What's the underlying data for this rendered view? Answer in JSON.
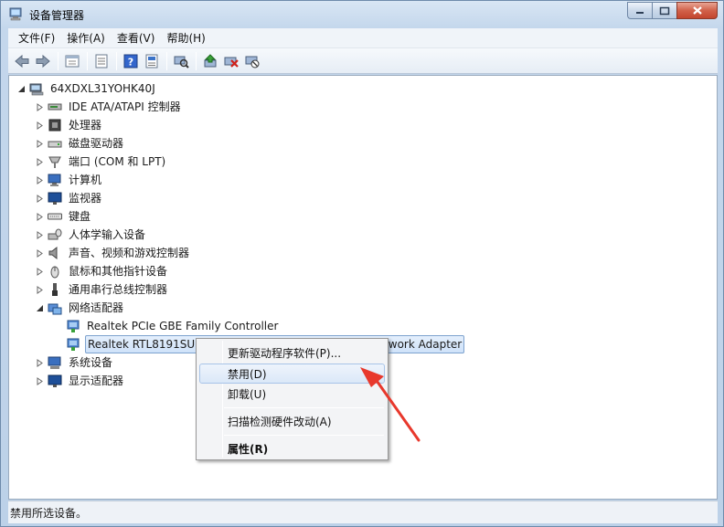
{
  "window": {
    "title": "设备管理器",
    "icons": {
      "app": "device-manager-icon",
      "minimize": "minimize-icon",
      "maximize": "maximize-icon",
      "close": "close-icon"
    }
  },
  "menu": [
    "文件(F)",
    "操作(A)",
    "查看(V)",
    "帮助(H)"
  ],
  "toolbar": {
    "buttons": [
      "back-icon",
      "forward-icon",
      "properties-view-icon",
      "list-view-icon",
      "help-icon",
      "resources-icon",
      "scan-hardware-icon",
      "update-driver-icon",
      "uninstall-icon",
      "disable-icon"
    ]
  },
  "tree": {
    "root": "64XDXL31YOHK40J",
    "categories": [
      {
        "label": "IDE ATA/ATAPI 控制器",
        "icon": "ide-controller-icon"
      },
      {
        "label": "处理器",
        "icon": "processor-icon"
      },
      {
        "label": "磁盘驱动器",
        "icon": "disk-drive-icon"
      },
      {
        "label": "端口 (COM 和 LPT)",
        "icon": "port-icon"
      },
      {
        "label": "计算机",
        "icon": "computer-icon"
      },
      {
        "label": "监视器",
        "icon": "monitor-icon"
      },
      {
        "label": "键盘",
        "icon": "keyboard-icon"
      },
      {
        "label": "人体学输入设备",
        "icon": "hid-icon"
      },
      {
        "label": "声音、视频和游戏控制器",
        "icon": "sound-icon"
      },
      {
        "label": "鼠标和其他指针设备",
        "icon": "mouse-icon"
      },
      {
        "label": "通用串行总线控制器",
        "icon": "usb-icon"
      },
      {
        "label": "网络适配器",
        "icon": "network-adapter-icon"
      }
    ],
    "network_children": [
      {
        "label": "Realtek PCIe GBE Family Controller",
        "icon": "network-card-icon"
      },
      {
        "label": "Realtek RTL8191SU Wireless LAN 802.11n USB 2.0 Network Adapter",
        "icon": "network-card-icon"
      }
    ],
    "after": [
      {
        "label": "系统设备",
        "icon": "system-device-icon"
      },
      {
        "label": "显示适配器",
        "icon": "display-adapter-icon"
      }
    ]
  },
  "context_menu": {
    "items": [
      "更新驱动程序软件(P)...",
      "禁用(D)",
      "卸载(U)",
      "扫描检测硬件改动(A)",
      "属性(R)"
    ]
  },
  "status": "禁用所选设备。",
  "colors": {
    "annotation_arrow": "#e8382c",
    "selection": "#cfe2f9"
  }
}
